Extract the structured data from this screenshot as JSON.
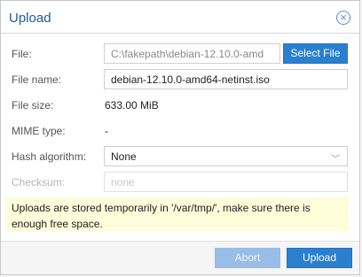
{
  "dialog": {
    "title": "Upload",
    "close_icon": "close-circle-icon"
  },
  "form": {
    "file": {
      "label": "File:",
      "value": "C:\\fakepath\\debian-12.10.0-amd",
      "button_label": "Select File"
    },
    "file_name": {
      "label": "File name:",
      "value": "debian-12.10.0-amd64-netinst.iso"
    },
    "file_size": {
      "label": "File size:",
      "value": "633.00 MiB"
    },
    "mime_type": {
      "label": "MIME type:",
      "value": "-"
    },
    "hash_algorithm": {
      "label": "Hash algorithm:",
      "value": "None"
    },
    "checksum": {
      "label": "Checksum:",
      "placeholder": "none"
    }
  },
  "note": "Uploads are stored temporarily in '/var/tmp/', make sure there is enough free space.",
  "footer": {
    "abort_label": "Abort",
    "upload_label": "Upload"
  },
  "colors": {
    "accent": "#2a7fd0",
    "title": "#1e5a9c",
    "note_bg": "#fefdd9"
  }
}
